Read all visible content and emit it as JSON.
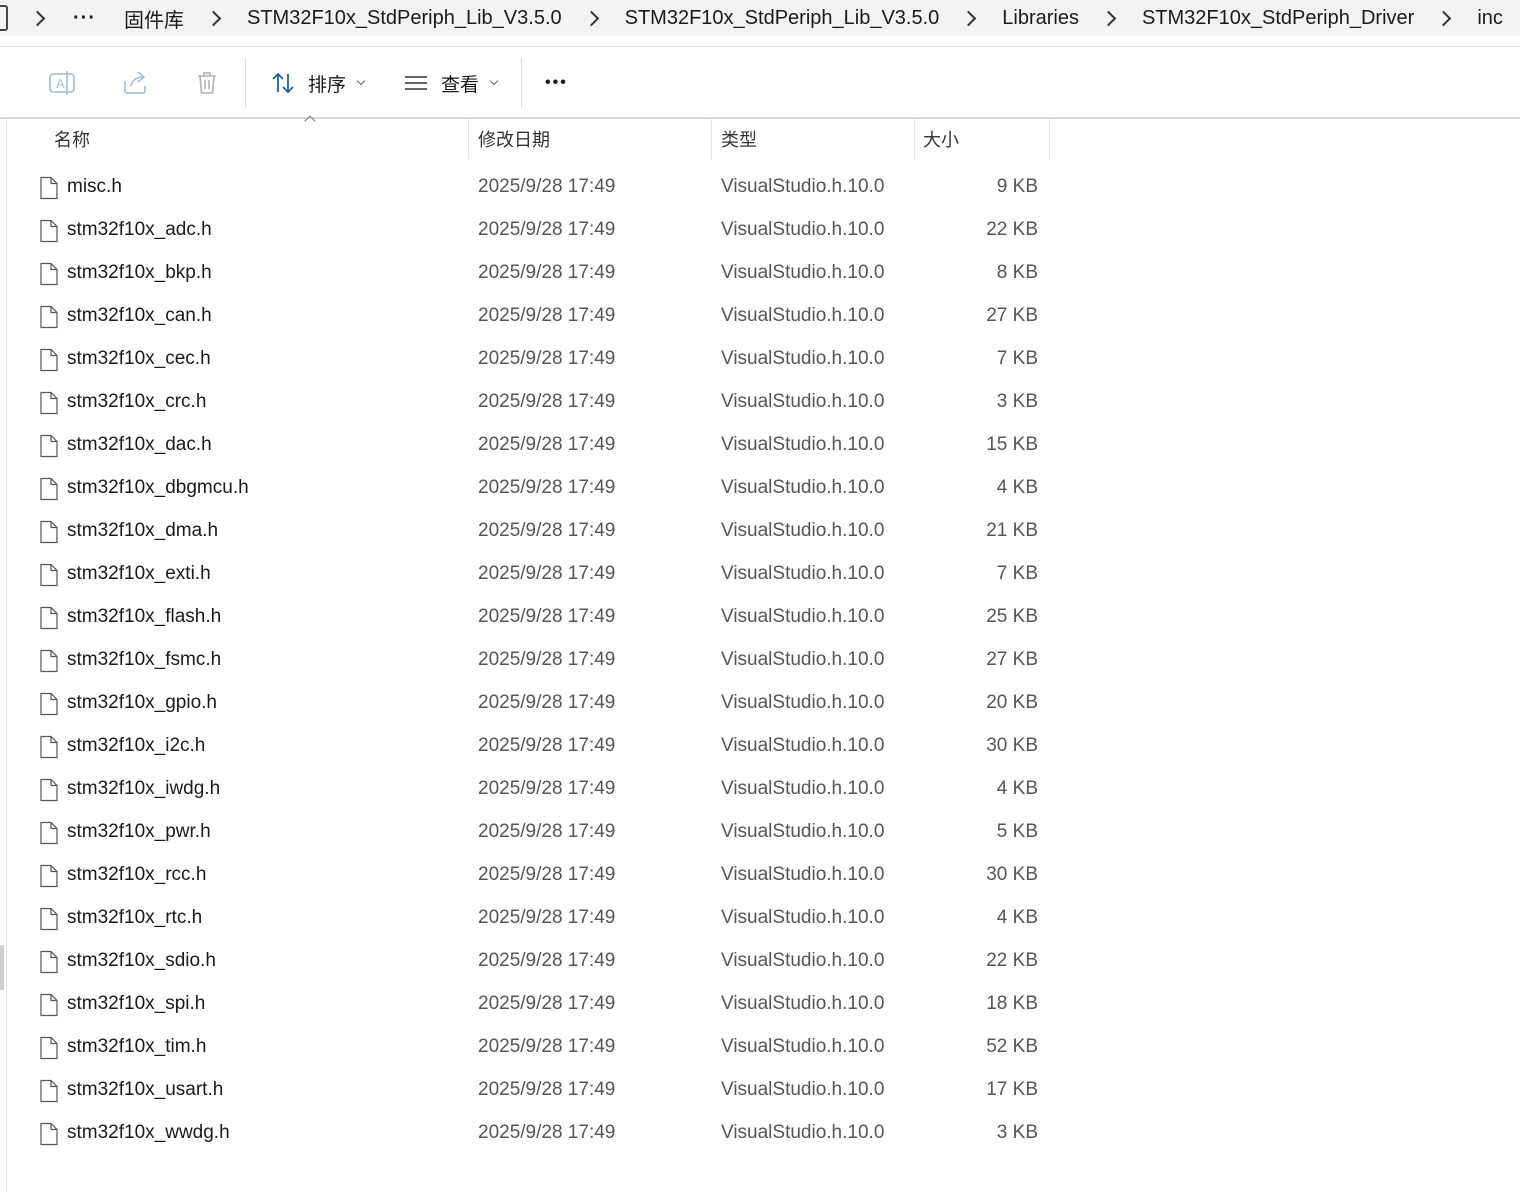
{
  "breadcrumb": {
    "more": "···",
    "items": [
      "固件库",
      "STM32F10x_StdPeriph_Lib_V3.5.0",
      "STM32F10x_StdPeriph_Lib_V3.5.0",
      "Libraries",
      "STM32F10x_StdPeriph_Driver",
      "inc"
    ]
  },
  "toolbar": {
    "sort_label": "排序",
    "view_label": "查看",
    "more_label": "•••"
  },
  "columns": {
    "name": "名称",
    "date": "修改日期",
    "type": "类型",
    "size": "大小"
  },
  "files": [
    {
      "name": "misc.h",
      "date": "2025/9/28 17:49",
      "type": "VisualStudio.h.10.0",
      "size": "9 KB"
    },
    {
      "name": "stm32f10x_adc.h",
      "date": "2025/9/28 17:49",
      "type": "VisualStudio.h.10.0",
      "size": "22 KB"
    },
    {
      "name": "stm32f10x_bkp.h",
      "date": "2025/9/28 17:49",
      "type": "VisualStudio.h.10.0",
      "size": "8 KB"
    },
    {
      "name": "stm32f10x_can.h",
      "date": "2025/9/28 17:49",
      "type": "VisualStudio.h.10.0",
      "size": "27 KB"
    },
    {
      "name": "stm32f10x_cec.h",
      "date": "2025/9/28 17:49",
      "type": "VisualStudio.h.10.0",
      "size": "7 KB"
    },
    {
      "name": "stm32f10x_crc.h",
      "date": "2025/9/28 17:49",
      "type": "VisualStudio.h.10.0",
      "size": "3 KB"
    },
    {
      "name": "stm32f10x_dac.h",
      "date": "2025/9/28 17:49",
      "type": "VisualStudio.h.10.0",
      "size": "15 KB"
    },
    {
      "name": "stm32f10x_dbgmcu.h",
      "date": "2025/9/28 17:49",
      "type": "VisualStudio.h.10.0",
      "size": "4 KB"
    },
    {
      "name": "stm32f10x_dma.h",
      "date": "2025/9/28 17:49",
      "type": "VisualStudio.h.10.0",
      "size": "21 KB"
    },
    {
      "name": "stm32f10x_exti.h",
      "date": "2025/9/28 17:49",
      "type": "VisualStudio.h.10.0",
      "size": "7 KB"
    },
    {
      "name": "stm32f10x_flash.h",
      "date": "2025/9/28 17:49",
      "type": "VisualStudio.h.10.0",
      "size": "25 KB"
    },
    {
      "name": "stm32f10x_fsmc.h",
      "date": "2025/9/28 17:49",
      "type": "VisualStudio.h.10.0",
      "size": "27 KB"
    },
    {
      "name": "stm32f10x_gpio.h",
      "date": "2025/9/28 17:49",
      "type": "VisualStudio.h.10.0",
      "size": "20 KB"
    },
    {
      "name": "stm32f10x_i2c.h",
      "date": "2025/9/28 17:49",
      "type": "VisualStudio.h.10.0",
      "size": "30 KB"
    },
    {
      "name": "stm32f10x_iwdg.h",
      "date": "2025/9/28 17:49",
      "type": "VisualStudio.h.10.0",
      "size": "4 KB"
    },
    {
      "name": "stm32f10x_pwr.h",
      "date": "2025/9/28 17:49",
      "type": "VisualStudio.h.10.0",
      "size": "5 KB"
    },
    {
      "name": "stm32f10x_rcc.h",
      "date": "2025/9/28 17:49",
      "type": "VisualStudio.h.10.0",
      "size": "30 KB"
    },
    {
      "name": "stm32f10x_rtc.h",
      "date": "2025/9/28 17:49",
      "type": "VisualStudio.h.10.0",
      "size": "4 KB"
    },
    {
      "name": "stm32f10x_sdio.h",
      "date": "2025/9/28 17:49",
      "type": "VisualStudio.h.10.0",
      "size": "22 KB"
    },
    {
      "name": "stm32f10x_spi.h",
      "date": "2025/9/28 17:49",
      "type": "VisualStudio.h.10.0",
      "size": "18 KB"
    },
    {
      "name": "stm32f10x_tim.h",
      "date": "2025/9/28 17:49",
      "type": "VisualStudio.h.10.0",
      "size": "52 KB"
    },
    {
      "name": "stm32f10x_usart.h",
      "date": "2025/9/28 17:49",
      "type": "VisualStudio.h.10.0",
      "size": "17 KB"
    },
    {
      "name": "stm32f10x_wwdg.h",
      "date": "2025/9/28 17:49",
      "type": "VisualStudio.h.10.0",
      "size": "3 KB"
    }
  ]
}
